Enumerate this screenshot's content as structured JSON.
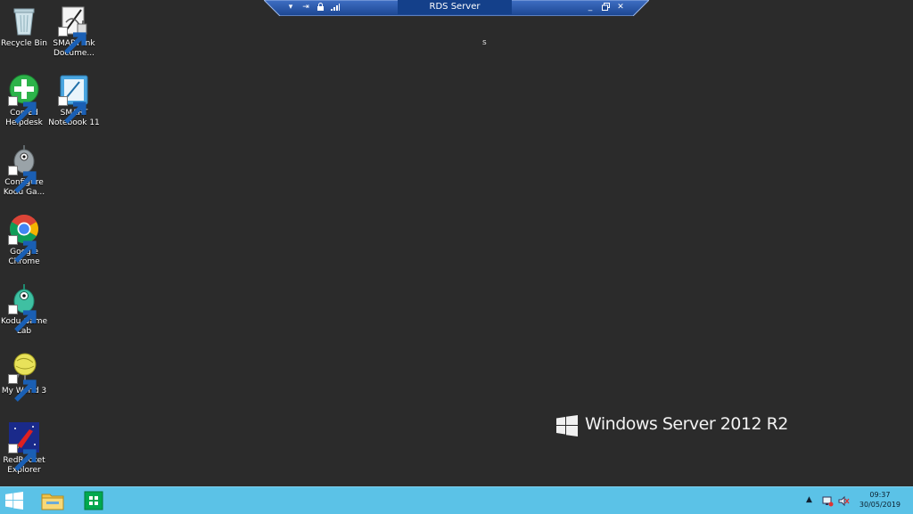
{
  "desktop": {
    "icons": [
      {
        "label": "Recycle Bin",
        "icon": "recycle-bin-icon"
      },
      {
        "label": "SMART Ink Docume...",
        "icon": "smart-ink-icon"
      },
      {
        "label": "Con Ed Helpdesk",
        "icon": "plus-icon"
      },
      {
        "label": "SMART Notebook 11",
        "icon": "smart-notebook-icon"
      },
      {
        "label": "Configure Kodu Ga...",
        "icon": "kodu-config-icon"
      },
      {
        "label": "Google Chrome",
        "icon": "chrome-icon"
      },
      {
        "label": "Kodu Game Lab",
        "icon": "kodu-icon"
      },
      {
        "label": "My World 3",
        "icon": "my-world-icon"
      },
      {
        "label": "RedRocket Explorer",
        "icon": "rocket-icon"
      }
    ],
    "center_text": "s"
  },
  "rdp_bar": {
    "title": "RDS Server",
    "left_icons": [
      "chevron-down-icon",
      "pin-icon",
      "lock-icon",
      "signal-icon"
    ],
    "right_icons": [
      "minimize-icon",
      "restore-icon",
      "close-icon"
    ]
  },
  "branding": {
    "text": "Windows Server 2012 R2"
  },
  "taskbar": {
    "items": [
      "start-icon",
      "file-explorer-icon",
      "store-icon"
    ],
    "tray_icons": [
      "tray-chevron-up-icon",
      "network-icon",
      "volume-muted-icon"
    ],
    "time": "09:37",
    "date": "30/05/2019"
  },
  "colors": {
    "desktop": "#2b2b2b",
    "taskbar": "#5bc2e7",
    "rdp_bar": "#1f4fa0"
  }
}
